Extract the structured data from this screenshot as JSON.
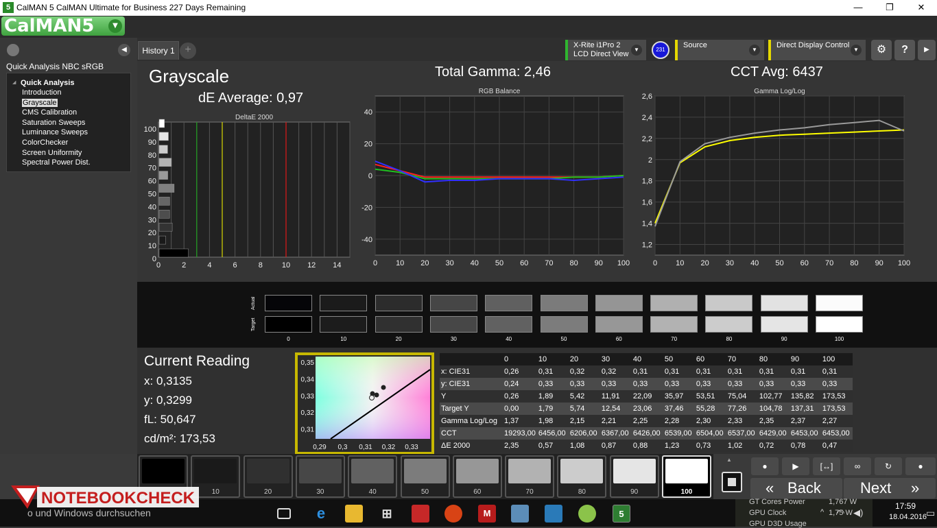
{
  "window": {
    "title": "CalMAN 5 CalMAN Ultimate for Business 227 Days Remaining",
    "minimize": "—",
    "maximize": "❐",
    "close": "✕"
  },
  "app": {
    "logo": "CalMAN5"
  },
  "sidebar": {
    "title": "Quick Analysis NBC sRGB",
    "group": "Quick Analysis",
    "items": [
      "Introduction",
      "Grayscale",
      "CMS Calibration",
      "Saturation Sweeps",
      "Luminance Sweeps",
      "ColorChecker",
      "Screen Uniformity",
      "Spectral Power Dist."
    ],
    "selected": "Grayscale"
  },
  "tabs": {
    "history": "History 1",
    "add": "+"
  },
  "devices": {
    "meter_line1": "X-Rite i1Pro 2",
    "meter_line2": "LCD Direct View",
    "meter_badge": "231",
    "source": "Source",
    "display": "Direct Display Control"
  },
  "header": {
    "page_title": "Grayscale",
    "total_gamma": "Total Gamma: 2,46",
    "cct_avg": "CCT Avg: 6437",
    "de_average": "dE Average: 0,97"
  },
  "colors": {
    "accent_green": "#3fa23f",
    "meter_green": "#2fb52f",
    "source_yellow": "#e5d800",
    "gamma_yellow": "#ffff00",
    "cie_border": "#c7b800"
  },
  "chart_data": [
    {
      "type": "bar",
      "title": "DeltaE 2000",
      "orientation": "horizontal",
      "categories": [
        "0",
        "10",
        "20",
        "30",
        "40",
        "50",
        "60",
        "70",
        "80",
        "90",
        "100"
      ],
      "values": [
        2.35,
        0.57,
        1.08,
        0.87,
        0.88,
        1.23,
        0.73,
        1.02,
        0.72,
        0.78,
        0.47
      ],
      "xlim": [
        0,
        15
      ],
      "xticks": [
        "0",
        "2",
        "4",
        "6",
        "8",
        "10",
        "12",
        "14"
      ],
      "yticks": [
        "100",
        "90",
        "80",
        "70",
        "60",
        "50",
        "40",
        "30",
        "20",
        "10",
        "0"
      ],
      "thresholds": [
        {
          "value": 3,
          "color": "#1fa01f"
        },
        {
          "value": 5,
          "color": "#d8d800"
        },
        {
          "value": 10,
          "color": "#e01818"
        }
      ]
    },
    {
      "type": "line",
      "title": "RGB Balance",
      "x": [
        0,
        10,
        20,
        30,
        40,
        50,
        60,
        70,
        80,
        90,
        100
      ],
      "ylim": [
        -50,
        50
      ],
      "xticks": [
        "0",
        "10",
        "20",
        "30",
        "40",
        "50",
        "60",
        "70",
        "80",
        "90",
        "100"
      ],
      "yticks": [
        "40",
        "20",
        "0",
        "-20",
        "-40"
      ],
      "series": [
        {
          "color": "#ff2020",
          "values": [
            7,
            3,
            -1,
            -1,
            -1,
            -1,
            -1,
            -1,
            -1,
            -1,
            0
          ]
        },
        {
          "color": "#20c020",
          "values": [
            4,
            2,
            -2,
            -2,
            -2,
            -2,
            -2,
            -2,
            -1,
            -1,
            0
          ]
        },
        {
          "color": "#3030ff",
          "values": [
            9,
            3,
            -4,
            -3,
            -3,
            -2,
            -2,
            -2,
            -3,
            -2,
            -1
          ]
        }
      ]
    },
    {
      "type": "line",
      "title": "Gamma Log/Log",
      "x": [
        0,
        10,
        20,
        30,
        40,
        50,
        60,
        70,
        80,
        90,
        100
      ],
      "ylim": [
        1.1,
        2.6
      ],
      "xticks": [
        "0",
        "10",
        "20",
        "30",
        "40",
        "50",
        "60",
        "70",
        "80",
        "90",
        "100"
      ],
      "yticks": [
        "2,6",
        "2,4",
        "2,2",
        "2",
        "1,8",
        "1,6",
        "1,4",
        "1,2"
      ],
      "series": [
        {
          "color": "#ffff00",
          "values": [
            1.4,
            1.97,
            2.12,
            2.18,
            2.21,
            2.23,
            2.24,
            2.25,
            2.26,
            2.27,
            2.28
          ]
        },
        {
          "color": "#9a9a9a",
          "values": [
            1.37,
            1.98,
            2.15,
            2.21,
            2.25,
            2.28,
            2.3,
            2.33,
            2.35,
            2.37,
            2.27
          ]
        }
      ]
    }
  ],
  "swatches": {
    "actual_label": "Actual",
    "target_label": "Target",
    "labels": [
      "0",
      "10",
      "20",
      "30",
      "40",
      "50",
      "60",
      "70",
      "80",
      "90",
      "100"
    ],
    "actual": [
      "#050508",
      "#1b1b1b",
      "#2c2c2c",
      "#464646",
      "#606060",
      "#7b7b7b",
      "#959595",
      "#b0b0b0",
      "#c9c9c9",
      "#e2e2e2",
      "#fbfbfb"
    ],
    "target": [
      "#000000",
      "#1c1c1c",
      "#303030",
      "#474747",
      "#616161",
      "#7c7c7c",
      "#979797",
      "#b2b2b2",
      "#cccccc",
      "#e5e5e5",
      "#ffffff"
    ]
  },
  "reading": {
    "title": "Current Reading",
    "x": "x: 0,3135",
    "y": "y: 0,3299",
    "fl": "fL: 50,647",
    "cdm2": "cd/m²: 173,53"
  },
  "cie": {
    "xticks": [
      "0,29",
      "0,3",
      "0,31",
      "0,32",
      "0,33"
    ],
    "yticks": [
      "0,35",
      "0,34",
      "0,33",
      "0,32",
      "0,31"
    ]
  },
  "table": {
    "headers": [
      "",
      "0",
      "10",
      "20",
      "30",
      "40",
      "50",
      "60",
      "70",
      "80",
      "90",
      "100"
    ],
    "rows": [
      [
        "x: CIE31",
        "0,26",
        "0,31",
        "0,32",
        "0,32",
        "0,31",
        "0,31",
        "0,31",
        "0,31",
        "0,31",
        "0,31",
        "0,31"
      ],
      [
        "y: CIE31",
        "0,24",
        "0,33",
        "0,33",
        "0,33",
        "0,33",
        "0,33",
        "0,33",
        "0,33",
        "0,33",
        "0,33",
        "0,33"
      ],
      [
        "Y",
        "0,26",
        "1,89",
        "5,42",
        "11,91",
        "22,09",
        "35,97",
        "53,51",
        "75,04",
        "102,77",
        "135,82",
        "173,53"
      ],
      [
        "Target Y",
        "0,00",
        "1,79",
        "5,74",
        "12,54",
        "23,06",
        "37,46",
        "55,28",
        "77,26",
        "104,78",
        "137,31",
        "173,53"
      ],
      [
        "Gamma Log/Log",
        "1,37",
        "1,98",
        "2,15",
        "2,21",
        "2,25",
        "2,28",
        "2,30",
        "2,33",
        "2,35",
        "2,37",
        "2,27"
      ],
      [
        "CCT",
        "19293,00",
        "6456,00",
        "6206,00",
        "6367,00",
        "6426,00",
        "6539,00",
        "6504,00",
        "6537,00",
        "6429,00",
        "6453,00",
        "6453,00"
      ],
      [
        "ΔE 2000",
        "2,35",
        "0,57",
        "1,08",
        "0,87",
        "0,88",
        "1,23",
        "0,73",
        "1,02",
        "0,72",
        "0,78",
        "0,47"
      ]
    ]
  },
  "patches": {
    "labels": [
      "",
      "10",
      "20",
      "30",
      "40",
      "50",
      "60",
      "70",
      "80",
      "90",
      "100"
    ],
    "colors": [
      "#000000",
      "#1a1a1a",
      "#303030",
      "#474747",
      "#616161",
      "#7c7c7c",
      "#979797",
      "#b2b2b2",
      "#cccccc",
      "#e5e5e5",
      "#ffffff"
    ],
    "selected": "100"
  },
  "nav": {
    "back": "Back",
    "next": "Next",
    "back_icon": "«",
    "next_icon": "»"
  },
  "watermark": {
    "text": "NOTEBOOKCHECK"
  },
  "taskbar": {
    "search_text": "o und Windows durchsuchen",
    "time": "17:59",
    "date": "18.04.2016",
    "hwinfo": [
      "GT Cores Power",
      "GPU Clock",
      "GPU D3D Usage"
    ],
    "hwvalues": [
      "1,767 W",
      "1,75 W"
    ]
  }
}
